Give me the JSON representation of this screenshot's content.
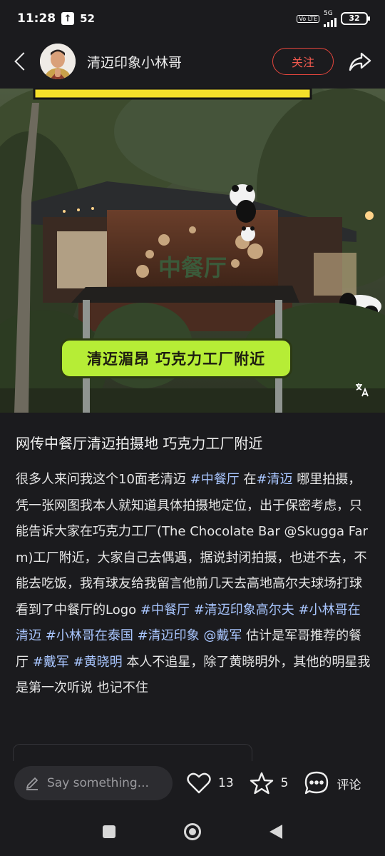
{
  "status_bar": {
    "time": "11:28",
    "notification_count": "52",
    "volte_label": "Vo LTE",
    "network": "5G",
    "battery": "32"
  },
  "header": {
    "author_name": "清迈印象小林哥",
    "follow_label": "关注"
  },
  "media": {
    "caption": "清迈湄昂  巧克力工厂附近",
    "sign_text": "中餐厅"
  },
  "post": {
    "title": "网传中餐厅清迈拍摄地 巧克力工厂附近",
    "body": [
      {
        "t": "很多人来问我这个10面老清迈 "
      },
      {
        "t": "#中餐厅",
        "tag": true
      },
      {
        "t": " 在"
      },
      {
        "t": "#清迈",
        "tag": true
      },
      {
        "t": " 哪里拍摄，凭一张网图我本人就知道具体拍摄地定位，出于保密考虑，只能告诉大家在巧克力工厂(The Chocolate Bar @Skugga Farm)工厂附近，大家自己去偶遇，据说封闭拍摄，也进不去，不能去吃饭，我有球友给我留言他前几天去高地高尔夫球场打球看到了中餐厅的Logo "
      },
      {
        "t": "#中餐厅",
        "tag": true
      },
      {
        "t": " "
      },
      {
        "t": "#清迈印象高尔夫",
        "tag": true
      },
      {
        "t": " "
      },
      {
        "t": "#小林哥在清迈",
        "tag": true
      },
      {
        "t": " "
      },
      {
        "t": "#小林哥在泰国",
        "tag": true
      },
      {
        "t": " "
      },
      {
        "t": "#清迈印象",
        "tag": true
      },
      {
        "t": " "
      },
      {
        "t": "@戴军",
        "tag": true
      },
      {
        "t": " 估计是军哥推荐的餐厅 "
      },
      {
        "t": "#戴军",
        "tag": true
      },
      {
        "t": " "
      },
      {
        "t": "#黄晓明",
        "tag": true
      },
      {
        "t": " 本人不追星，除了黄晓明外，其他的明星我是第一次听说 也记不住"
      }
    ]
  },
  "bottom_bar": {
    "comment_placeholder": "Say something...",
    "like_count": "13",
    "star_count": "5",
    "comment_label": "评论"
  },
  "colors": {
    "background": "#1b1b1e",
    "accent_red": "#e2453c",
    "caption_green": "#b6ed36",
    "hashtag_blue": "#a9c6ff"
  }
}
